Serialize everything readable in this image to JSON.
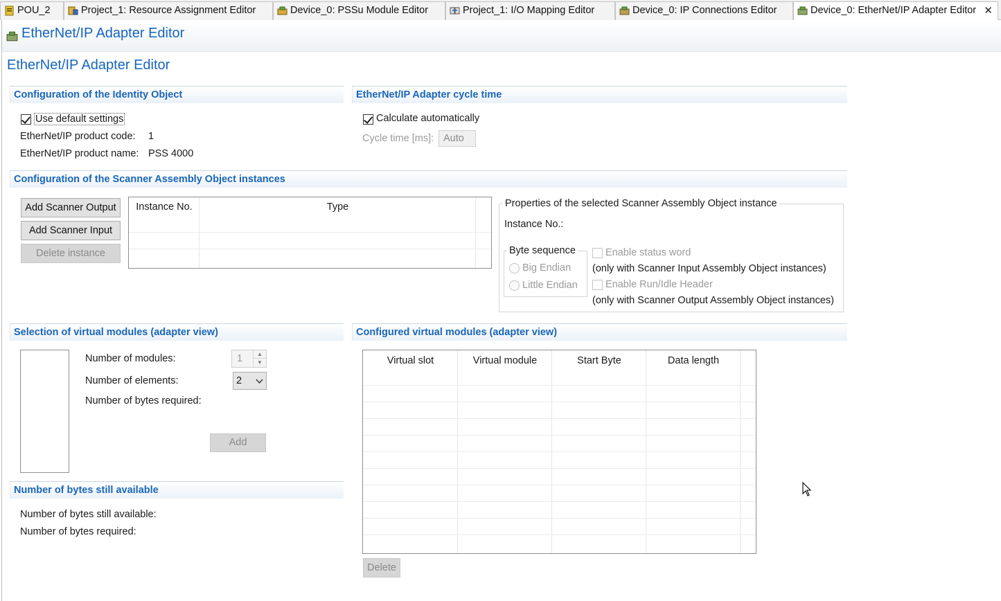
{
  "tabs": [
    {
      "label": "POU_2",
      "icon": "pou-icon"
    },
    {
      "label": "Project_1: Resource Assignment Editor",
      "icon": "resource-assignment-icon"
    },
    {
      "label": "Device_0: PSSu Module Editor",
      "icon": "module-editor-icon"
    },
    {
      "label": "Project_1: I/O Mapping Editor",
      "icon": "io-mapping-icon"
    },
    {
      "label": "Device_0: IP Connections Editor",
      "icon": "ip-connections-icon"
    },
    {
      "label": "Device_0: EtherNet/IP Adapter Editor",
      "icon": "adapter-editor-icon",
      "active": true
    }
  ],
  "editor": {
    "header_title": "EtherNet/IP Adapter Editor",
    "page_title": "EtherNet/IP Adapter Editor"
  },
  "identity": {
    "section_title": "Configuration of the Identity Object",
    "use_default_label": "Use default settings",
    "use_default_checked": true,
    "product_code_label": "EtherNet/IP product code:",
    "product_code_value": "1",
    "product_name_label": "EtherNet/IP product name:",
    "product_name_value": "PSS 4000"
  },
  "cycle": {
    "section_title": "EtherNet/IP Adapter cycle time",
    "calc_label": "Calculate automatically",
    "calc_checked": true,
    "cycle_time_label": "Cycle time [ms]:",
    "cycle_time_value": "Auto"
  },
  "scanner": {
    "section_title": "Configuration of the Scanner Assembly Object instances",
    "add_output_label": "Add Scanner Output",
    "add_input_label": "Add Scanner Input",
    "delete_label": "Delete instance",
    "table_headers": [
      "Instance No.",
      "Type"
    ],
    "properties_title": "Properties of the selected Scanner Assembly Object instance",
    "instance_no_label": "Instance No.:",
    "byte_sequence_title": "Byte sequence",
    "big_endian_label": "Big Endian",
    "little_endian_label": "Little Endian",
    "status_word_label": "Enable status word",
    "status_word_note": "(only with Scanner Input Assembly Object instances)",
    "run_idle_label": "Enable Run/Idle Header",
    "run_idle_note": "(only with Scanner Output Assembly Object instances)"
  },
  "selection": {
    "section_title": "Selection of virtual modules (adapter view)",
    "num_modules_label": "Number of modules:",
    "num_modules_value": "1",
    "num_elements_label": "Number of elements:",
    "num_elements_value": "2",
    "bytes_required_label": "Number of bytes required:",
    "add_label": "Add"
  },
  "available": {
    "section_title": "Number of bytes still available",
    "still_available_label": "Number of bytes still available:",
    "required_label": "Number of bytes required:"
  },
  "configured": {
    "section_title": "Configured virtual modules (adapter view)",
    "table_headers": [
      "Virtual slot",
      "Virtual module",
      "Start Byte",
      "Data length"
    ],
    "delete_label": "Delete"
  },
  "colors": {
    "accent": "#1565c0",
    "section_text": "#1a66b8"
  }
}
